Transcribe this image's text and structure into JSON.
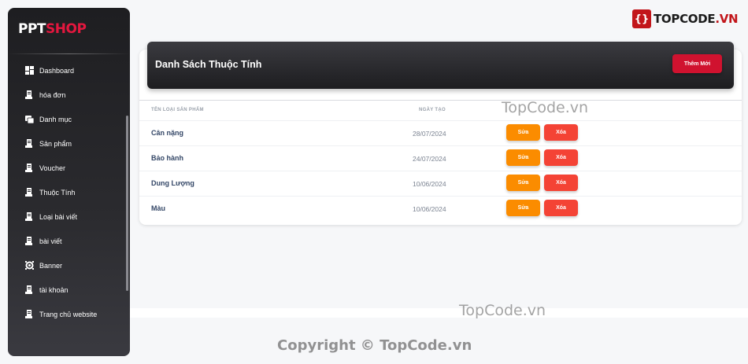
{
  "brand": {
    "part1": "PPT",
    "part2": "SHOP"
  },
  "sidebar": {
    "items": [
      {
        "label": "Dashboard",
        "icon": "dashboard-icon"
      },
      {
        "label": "hóa đơn",
        "icon": "receipt-icon"
      },
      {
        "label": "Danh mục",
        "icon": "folder-icon"
      },
      {
        "label": "Sản phẩm",
        "icon": "receipt-icon"
      },
      {
        "label": "Voucher",
        "icon": "receipt-icon"
      },
      {
        "label": "Thuộc Tính",
        "icon": "receipt-icon"
      },
      {
        "label": "Loại bài viết",
        "icon": "receipt-icon"
      },
      {
        "label": "bài viết",
        "icon": "receipt-icon"
      },
      {
        "label": "Banner",
        "icon": "settings-icon"
      },
      {
        "label": "tài khoản",
        "icon": "receipt-icon"
      },
      {
        "label": "Trang chủ website",
        "icon": "receipt-icon"
      }
    ]
  },
  "main": {
    "title": "Danh Sách Thuộc Tính",
    "add_label": "Thêm Mới",
    "columns": {
      "name": "Tên loại sản phẩm",
      "date": "Ngày tạo"
    },
    "edit_label": "Sửa",
    "delete_label": "Xóa",
    "rows": [
      {
        "name": "Cân nặng",
        "date": "28/07/2024"
      },
      {
        "name": "Bảo hành",
        "date": "24/07/2024"
      },
      {
        "name": "Dung Lượng",
        "date": "10/06/2024"
      },
      {
        "name": "Màu",
        "date": "10/06/2024"
      }
    ]
  },
  "watermark": {
    "logo_text_a": "TOPCODE",
    "logo_text_b": ".VN",
    "text1": "TopCode.vn",
    "text2": "TopCode.vn",
    "copyright": "Copyright © TopCode.vn"
  },
  "colors": {
    "accent": "#d0122f",
    "edit": "#fb8c00",
    "delete": "#f44335",
    "sidebar": "#1e1e21"
  }
}
